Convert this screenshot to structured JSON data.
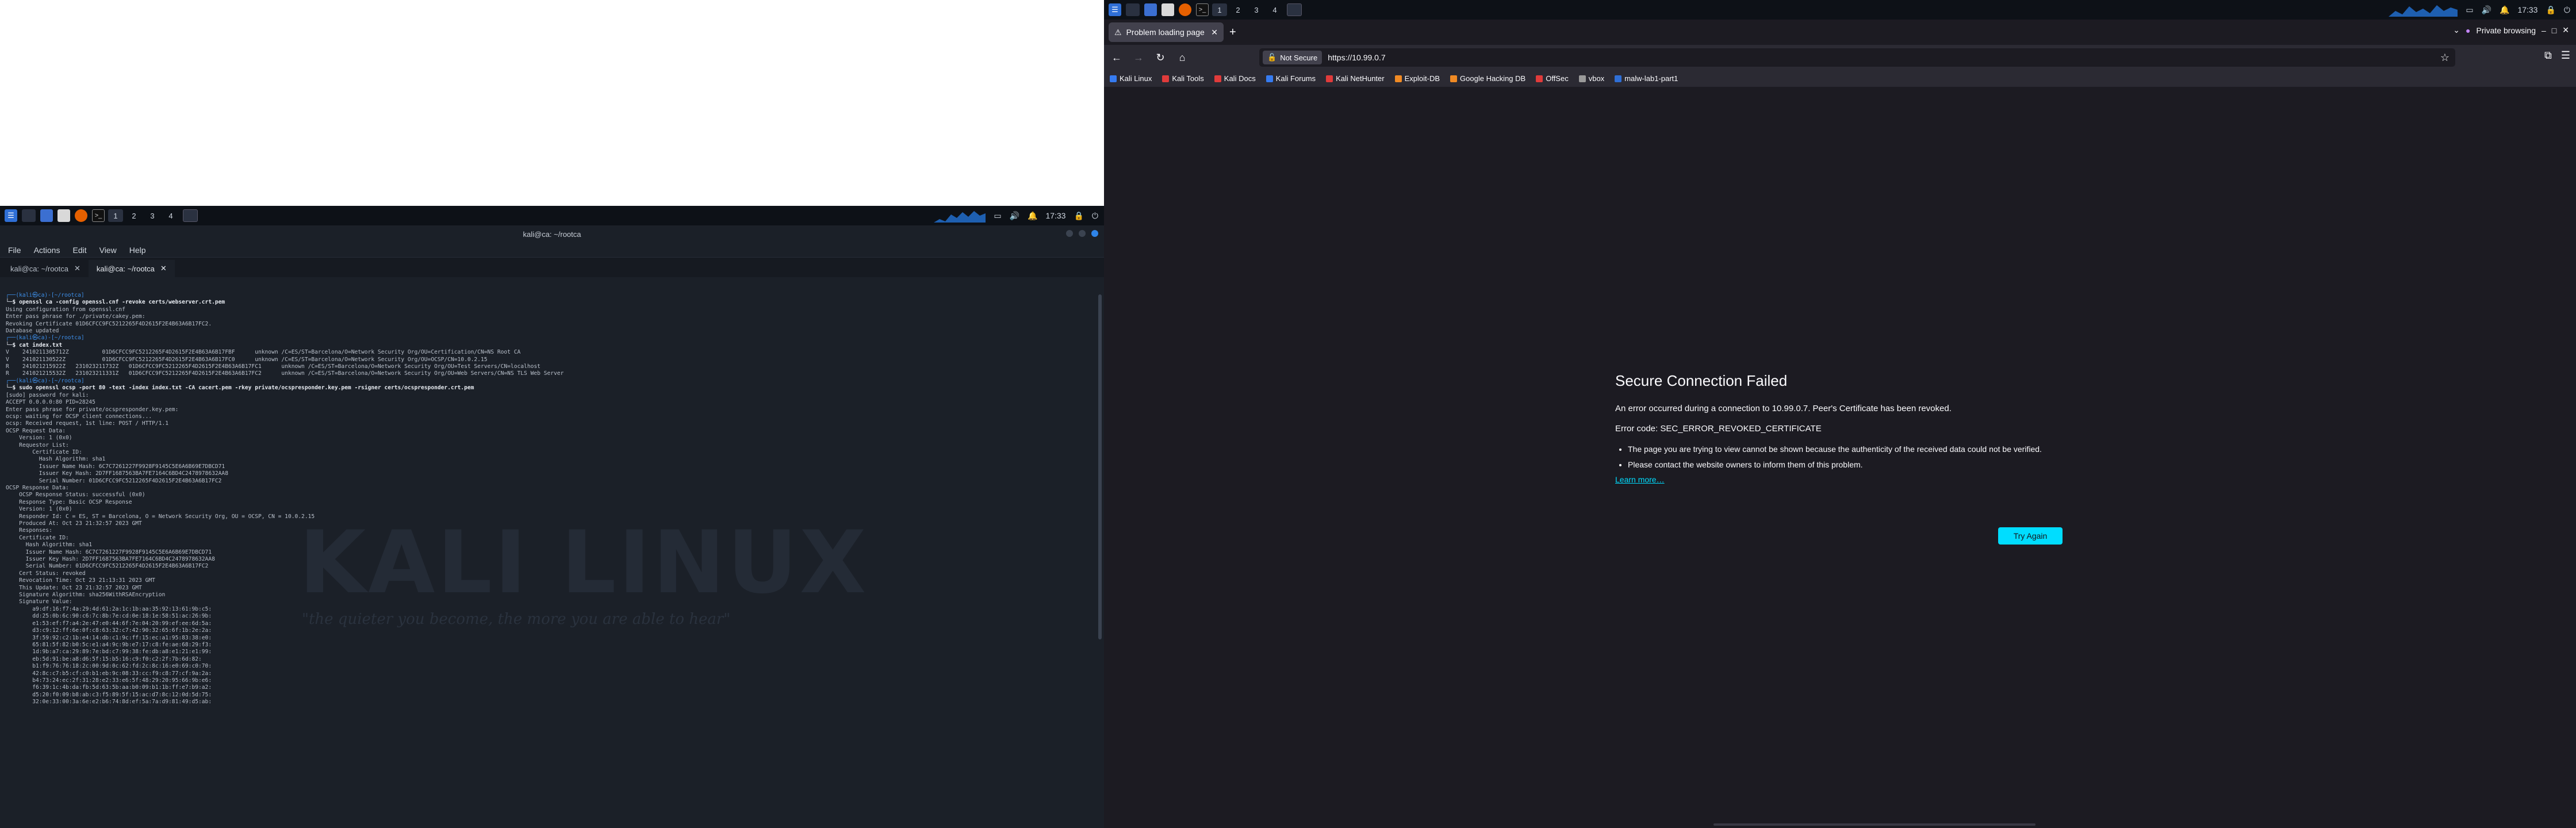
{
  "left": {
    "panel": {
      "workspaces": [
        "1",
        "2",
        "3",
        "4"
      ],
      "clock": "17:33"
    },
    "terminal": {
      "title": "kali@ca: ~/rootca",
      "menu": [
        "File",
        "Actions",
        "Edit",
        "View",
        "Help"
      ],
      "tabs": [
        "kali@ca: ~/rootca",
        "kali@ca: ~/rootca"
      ],
      "lines": [
        "┌──(kali㉿ca)-[~/rootca]",
        "└─$ openssl ca -config openssl.cnf -revoke certs/webserver.crt.pem",
        "Using configuration from openssl.cnf",
        "Enter pass phrase for ./private/cakey.pem:",
        "Revoking Certificate 01D6CFCC9FC5212265F4D2615F2E4B63A6B17FC2.",
        "Database updated",
        "",
        "┌──(kali㉿ca)-[~/rootca]",
        "└─$ cat index.txt",
        "V    2410211305712Z          01D6CFCC9FC5212265F4D2615F2E4B63A6B17FBF      unknown /C=ES/ST=Barcelona/O=Network Security Org/OU=Certification/CN=NS Root CA",
        "V    241021130522Z           01D6CFCC9FC5212265F4D2615F2E4B63A6B17FC0      unknown /C=ES/ST=Barcelona/O=Network Security Org/OU=OCSP/CN=10.0.2.15",
        "R    241021215922Z   231023211732Z   01D6CFCC9FC5212265F4D2615F2E4B63A6B17FC1      unknown /C=ES/ST=Barcelona/O=Network Security Org/OU=Test Servers/CN=localhost",
        "R    241021215532Z   231023211331Z   01D6CFCC9FC5212265F4D2615F2E4B63A6B17FC2      unknown /C=ES/ST=Barcelona/O=Network Security Org/OU=Web Servers/CN=NS TLS Web Server",
        "",
        "┌──(kali㉿ca)-[~/rootca]",
        "└─$ sudo openssl ocsp -port 80 -text -index index.txt -CA cacert.pem -rkey private/ocspresponder.key.pem -rsigner certs/ocspresponder.crt.pem",
        "[sudo] password for kali:",
        "ACCEPT 0.0.0.0:80 PID=28245",
        "Enter pass phrase for private/ocspresponder.key.pem:",
        "ocsp: waiting for OCSP client connections...",
        "ocsp: Received request, 1st line: POST / HTTP/1.1",
        "OCSP Request Data:",
        "    Version: 1 (0x0)",
        "    Requestor List:",
        "        Certificate ID:",
        "          Hash Algorithm: sha1",
        "          Issuer Name Hash: 6C7C7261227F9928F9145C5E6A6B69E7DBCD71",
        "          Issuer Key Hash: 2D7FF1687563BA7FE7164C6BD4C2478978632AA8",
        "          Serial Number: 01D6CFCC9FC5212265F4D2615F2E4B63A6B17FC2",
        "OCSP Response Data:",
        "    OCSP Response Status: successful (0x0)",
        "    Response Type: Basic OCSP Response",
        "    Version: 1 (0x0)",
        "    Responder Id: C = ES, ST = Barcelona, O = Network Security Org, OU = OCSP, CN = 10.0.2.15",
        "    Produced At: Oct 23 21:32:57 2023 GMT",
        "    Responses:",
        "    Certificate ID:",
        "      Hash Algorithm: sha1",
        "      Issuer Name Hash: 6C7C7261227F9928F9145C5E6A6B69E7DBCD71",
        "      Issuer Key Hash: 2D7FF1687563BA7FE7164C6BD4C2478978632AA8",
        "      Serial Number: 01D6CFCC9FC5212265F4D2615F2E4B63A6B17FC2",
        "    Cert Status: revoked",
        "    Revocation Time: Oct 23 21:13:31 2023 GMT",
        "    This Update: Oct 23 21:32:57 2023 GMT",
        "",
        "    Signature Algorithm: sha256WithRSAEncryption",
        "    Signature Value:",
        "        a9:df:16:f7:4a:29:4d:61:2a:1c:1b:aa:35:92:13:61:9b:c5:",
        "        dd:25:0b:6c:90:c6:7c:8b:7e:cd:0e:18:1e:58:51:ac:26:9b:",
        "        e1:53:ef:f7:a4:2e:47:e0:44:6f:7e:04:20:99:ef:ee:6d:5a:",
        "        d3:c9:12:ff:6e:0f:c8:63:32:c7:42:90:32:65:6f:1b:2e:2a:",
        "        3f:59:92:c2:1b:e4:14:db:c1:9c:ff:15:ec:a1:95:83:38:e0:",
        "        65:81:5f:82:b0:5c:e1:a4:9c:9b:e7:17:c8:fe:ae:68:29:f3:",
        "        1d:9b:a7:ca:29:89:7e:bd:c7:99:38:fe:db:a8:e1:21:e1:99:",
        "        eb:5d:91:be:a8:d6:5f:15:b5:16:c9:f0:c2:2f:7b:6d:82:",
        "        b1:f9:76:76:18:2c:00:9d:0c:62:fd:2c:8c:16:e0:69:c0:70:",
        "        42:8c:c7:b5:cf:c0:b1:eb:9c:08:33:cc:f9:c8:77:cf:9a:2a:",
        "        b4:73:24:ec:2f:31:28:e2:33:e6:5f:48:29:20:95:66:9b:e6:",
        "        f6:39:1c:4b:da:fb:5d:63:5b:aa:b0:09:b1:1b:ff:e7:b9:a2:",
        "        d5:20:f0:09:b8:ab:c3:f5:89:5f:15:ac:d7:8c:12:0d:5d:75:",
        "        32:0e:33:00:3a:6e:e2:b6:74:8d:ef:5a:7a:d9:81:49:d5:ab:"
      ],
      "watermark": "KALI LINUX",
      "watermark_tagline": "\"the quieter you become, the more you are able to hear\""
    }
  },
  "right": {
    "panel": {
      "workspaces": [
        "1",
        "2",
        "3",
        "4"
      ],
      "clock": "17:33"
    },
    "tab_title": "Problem loading page",
    "private_label": "Private browsing",
    "url": {
      "not_secure": "Not Secure",
      "address": "https://10.99.0.7"
    },
    "bookmarks": [
      {
        "label": "Kali Linux",
        "color": "#367bf0"
      },
      {
        "label": "Kali Tools",
        "color": "#e03b3b"
      },
      {
        "label": "Kali Docs",
        "color": "#e03b3b"
      },
      {
        "label": "Kali Forums",
        "color": "#367bf0"
      },
      {
        "label": "Kali NetHunter",
        "color": "#e03b3b"
      },
      {
        "label": "Exploit-DB",
        "color": "#f08a24"
      },
      {
        "label": "Google Hacking DB",
        "color": "#f08a24"
      },
      {
        "label": "OffSec",
        "color": "#e03b3b"
      },
      {
        "label": "vbox",
        "color": "#9a9a9a"
      },
      {
        "label": "malw-lab1-part1",
        "color": "#2f6fd6"
      }
    ],
    "error": {
      "title": "Secure Connection Failed",
      "message": "An error occurred during a connection to 10.99.0.7. Peer's Certificate has been revoked.",
      "code": "Error code: SEC_ERROR_REVOKED_CERTIFICATE",
      "bullets": [
        "The page you are trying to view cannot be shown because the authenticity of the received data could not be verified.",
        "Please contact the website owners to inform them of this problem."
      ],
      "learn_more": "Learn more…",
      "try_again": "Try Again"
    }
  },
  "colors": {
    "accent": "#00ddff",
    "kali_blue": "#367bf0",
    "terminal_bg": "#1b2028",
    "firefox_bg": "#1c1b22"
  }
}
